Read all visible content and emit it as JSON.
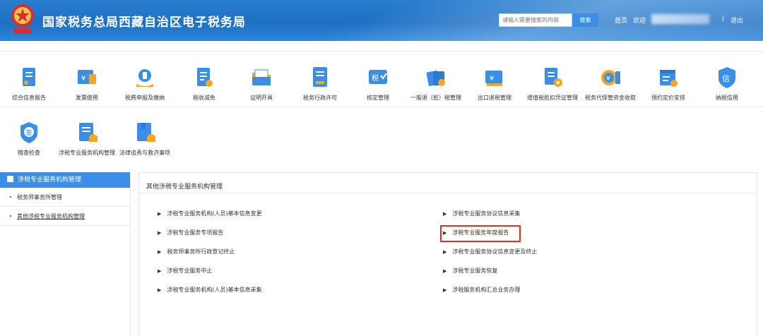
{
  "header": {
    "title": "国家税务总局西藏自治区电子税务局",
    "search_placeholder": "请输入需要搜索的内容",
    "search_button": "搜索",
    "home": "首页",
    "welcome": "欢迎",
    "logout": "退出",
    "divider": "|"
  },
  "functions": [
    {
      "label": "综合信息报告",
      "icon": "report-icon"
    },
    {
      "label": "发票使用",
      "icon": "invoice-icon"
    },
    {
      "label": "税费申报及缴纳",
      "icon": "tax-payment-icon"
    },
    {
      "label": "税收减免",
      "icon": "tax-reduction-icon"
    },
    {
      "label": "证明开具",
      "icon": "certificate-icon"
    },
    {
      "label": "税务行政许可",
      "icon": "permit-icon"
    },
    {
      "label": "核定管理",
      "icon": "assessment-icon"
    },
    {
      "label": "一般退（抵）税管理",
      "icon": "refund-icon"
    },
    {
      "label": "出口退税管理",
      "icon": "export-refund-icon"
    },
    {
      "label": "增值税抵扣凭证管理",
      "icon": "vat-voucher-icon"
    },
    {
      "label": "税务代保管资金收取",
      "icon": "custody-fund-icon"
    },
    {
      "label": "预约定价安排",
      "icon": "pricing-icon"
    },
    {
      "label": "纳税信用",
      "icon": "credit-icon"
    },
    {
      "label": "稽查检查",
      "icon": "inspection-icon"
    },
    {
      "label": "涉税专业服务机构管理",
      "icon": "agency-icon"
    },
    {
      "label": "法律追责与救济事项",
      "icon": "legal-icon"
    }
  ],
  "sidebar": {
    "title": "涉税专业服务机构管理",
    "items": [
      "税务师事务所管理",
      "其他涉税专业服务机构管理"
    ]
  },
  "panel": {
    "title": "其他涉税专业服务机构管理",
    "links_left": [
      "涉税专业服务机构(人员)基本信息变更",
      "涉税专业服务专项报告",
      "税务师事务所行政登记终止",
      "涉税专业服务中止",
      "涉税专业服务机构(人员)基本信息采集"
    ],
    "links_right": [
      "涉税专业服务协议信息采集",
      "涉税专业服务年度报告",
      "涉税专业服务协议信息变更及终止",
      "涉税专业服务恢复",
      "涉税服务机构汇总业务办理"
    ],
    "arrow": "▶"
  },
  "colors": {
    "primary": "#3a8ee6",
    "header": "#1f6fc4",
    "highlight": "#e0302b"
  }
}
